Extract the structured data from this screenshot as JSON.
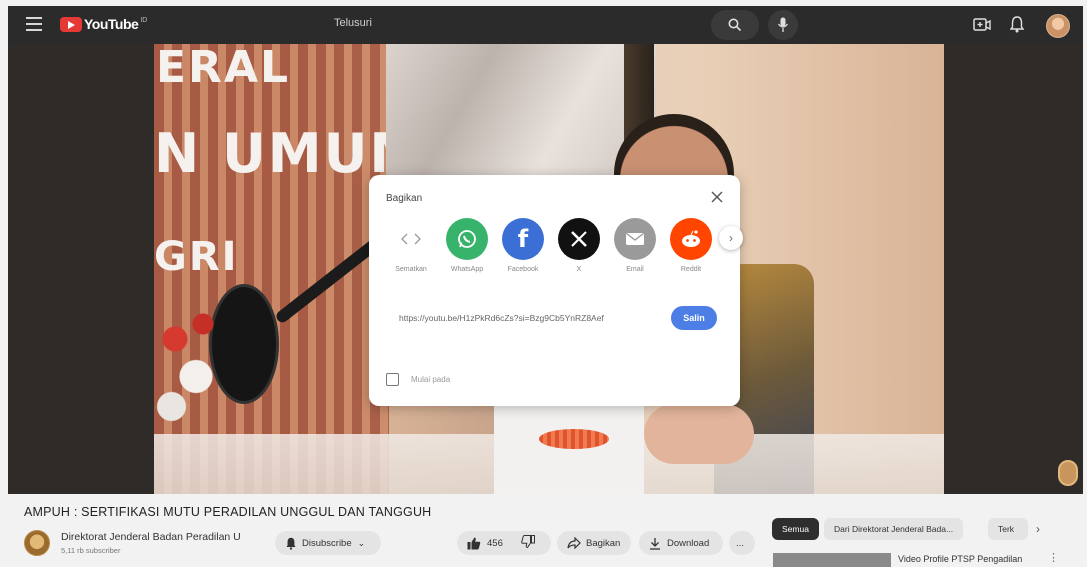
{
  "header": {
    "logo_text": "YouTube",
    "logo_sup": "ID",
    "search_placeholder": "Telusuri"
  },
  "video": {
    "wall_text_1": "ERAL",
    "wall_text_2": "N UMUM",
    "wall_text_3": "GRI"
  },
  "share_dialog": {
    "title": "Bagikan",
    "items": [
      {
        "label": "Sematkan",
        "icon": "embed-icon",
        "color": "#ffffff"
      },
      {
        "label": "WhatsApp",
        "icon": "whatsapp-icon",
        "color": "#38b36b"
      },
      {
        "label": "Facebook",
        "icon": "facebook-icon",
        "color": "#3b6fd6"
      },
      {
        "label": "X",
        "icon": "x-icon",
        "color": "#111111"
      },
      {
        "label": "Email",
        "icon": "email-icon",
        "color": "#9a9a9a"
      },
      {
        "label": "Reddit",
        "icon": "reddit-icon",
        "color": "#ff4500"
      }
    ],
    "link": "https://youtu.be/H1zPkRd6cZs?si=Bzg9Cb5YnRZ8Aef",
    "copy_label": "Salin",
    "start_at_label": "Mulai pada"
  },
  "info": {
    "title": "AMPUH : SERTIFIKASI MUTU PERADILAN UNGGUL DAN TANGGUH",
    "channel_name": "Direktorat Jenderal Badan Peradilan U",
    "subscribers": "5,11 rb subscriber",
    "subscribe_label": "Disubscribe",
    "likes": "456",
    "share_label": "Bagikan",
    "download_label": "Download",
    "more_label": "..."
  },
  "sidebar": {
    "chips": [
      {
        "label": "Semua",
        "active": true
      },
      {
        "label": "Dari Direktorat Jenderal Bada...",
        "active": false
      },
      {
        "label": "Terk",
        "active": false
      }
    ],
    "rec_title": "Video Profile PTSP Pengadilan"
  },
  "colors": {
    "accent_copy": "#4d7ee6",
    "youtube_red": "#e53935"
  }
}
